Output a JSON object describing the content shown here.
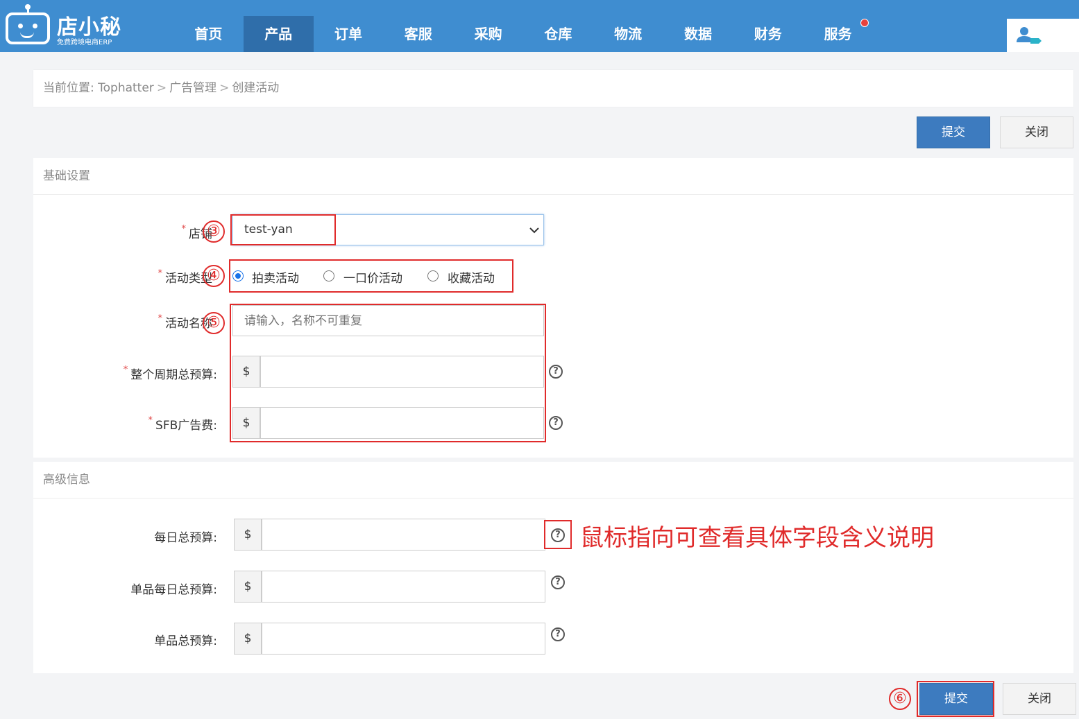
{
  "app": {
    "logo_name": "店小秘",
    "logo_sub": "免费跨境电商ERP"
  },
  "nav": {
    "items": [
      "首页",
      "产品",
      "订单",
      "客服",
      "采购",
      "仓库",
      "物流",
      "数据",
      "财务",
      "服务"
    ],
    "active": "产品"
  },
  "breadcrumb": {
    "prefix": "当前位置:",
    "items": [
      "Tophatter",
      "广告管理",
      "创建活动"
    ]
  },
  "actions": {
    "submit": "提交",
    "close": "关闭"
  },
  "basic": {
    "title": "基础设置",
    "store_label": "店铺",
    "store_value": "test-yan",
    "type_label": "活动类型",
    "type_options": [
      "拍卖活动",
      "一口价活动",
      "收藏活动"
    ],
    "type_selected": "拍卖活动",
    "name_label": "活动名称",
    "name_placeholder": "请输入，名称不可重复",
    "budget_label": "整个周期总预算:",
    "sfb_label": "SFB广告费:"
  },
  "advanced": {
    "title": "高级信息",
    "daily_label": "每日总预算:",
    "item_daily_label": "单品每日总预算:",
    "item_total_label": "单品总预算:"
  },
  "currency": "$",
  "help_glyph": "?",
  "annotations": {
    "step3": "③",
    "step4": "④",
    "step5": "⑤",
    "step6": "⑥",
    "tooltip_note": "鼠标指向可查看具体字段含义说明"
  },
  "colors": {
    "header": "#3f8dd0",
    "primary": "#3d7bbf",
    "annotation": "#e02b2b"
  }
}
